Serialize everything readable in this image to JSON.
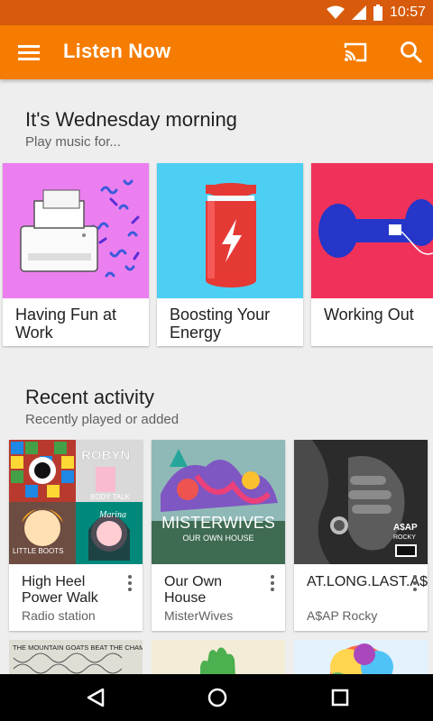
{
  "status": {
    "time": "10:57"
  },
  "appbar": {
    "title": "Listen Now"
  },
  "moods": {
    "heading": "It's Wednesday morning",
    "subheading": "Play music for...",
    "items": [
      {
        "label": "Having Fun at Work"
      },
      {
        "label": "Boosting Your Energy"
      },
      {
        "label": "Working Out"
      }
    ]
  },
  "recent": {
    "heading": "Recent activity",
    "subheading": "Recently played or added",
    "items": [
      {
        "name": "High Heel Power Walk",
        "sub": "Radio station"
      },
      {
        "name": "Our Own House",
        "sub": "MisterWives"
      },
      {
        "name": "AT.LONG.LAST.A$AP",
        "sub": "A$AP Rocky"
      }
    ]
  },
  "art_text": {
    "robyn": "ROBYN",
    "body_talk": "BODY TALK",
    "little_boots": "LITTLE BOOTS",
    "marina": "Marina",
    "misterwives": "MISTERWIVES",
    "our_own_house": "OUR OWN HOUSE",
    "asap": "A$AP",
    "rocky": "ROCKY",
    "mountain_goats": "THE MOUNTAIN GOATS BEAT THE CHAMP"
  },
  "colors": {
    "statusbar": "#d75b0a",
    "appbar": "#f57c00",
    "mood1_bg": "#ec7ff0",
    "mood2_bg": "#4dcff3",
    "mood3_bg": "#f0325a"
  }
}
